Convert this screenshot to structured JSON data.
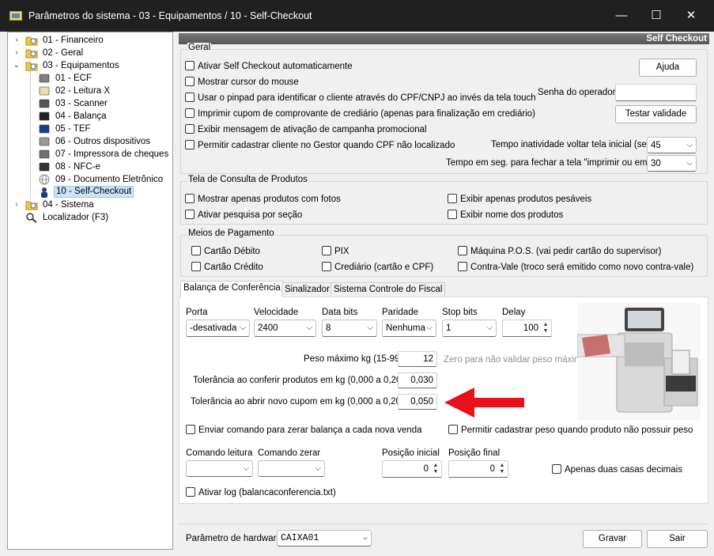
{
  "window": {
    "title": "Parâmetros do sistema - 03 - Equipamentos / 10 - Self-Checkout",
    "minimize": "—",
    "maximize": "☐",
    "close": "✕"
  },
  "tree": [
    {
      "label": "01 - Financeiro",
      "icon": "folder-search-icon",
      "expand": "›"
    },
    {
      "label": "02 - Geral",
      "icon": "folder-search-icon",
      "expand": "›"
    },
    {
      "label": "03 - Equipamentos",
      "icon": "open-folder-icon",
      "expand": "⌄"
    },
    {
      "label": "01 - ECF",
      "icon": "printer-icon"
    },
    {
      "label": "02 - Leitura X",
      "icon": "document-icon"
    },
    {
      "label": "03 - Scanner",
      "icon": "scanner-icon"
    },
    {
      "label": "04 - Balança",
      "icon": "scale-icon"
    },
    {
      "label": "05 - TEF",
      "icon": "card-icon"
    },
    {
      "label": "06 - Outros dispositivos",
      "icon": "devices-icon"
    },
    {
      "label": "07 - Impressora de cheques",
      "icon": "check-printer-icon"
    },
    {
      "label": "08 - NFC-e",
      "icon": "qr-code-icon"
    },
    {
      "label": "09 - Documento Eletrônico",
      "icon": "globe-icon"
    },
    {
      "label": "10 - Self-Checkout",
      "icon": "person-icon"
    },
    {
      "label": "04 - Sistema",
      "icon": "folder-search-icon",
      "expand": "›"
    },
    {
      "label": "Localizador (F3)",
      "icon": "magnifier-icon"
    }
  ],
  "header": "Self Checkout",
  "geral": {
    "legend": "Geral",
    "checks": [
      "Ativar Self Checkout automaticamente",
      "Mostrar cursor do mouse",
      "Usar o pinpad para identificar o cliente através do CPF/CNPJ ao invés da tela touch",
      "Imprimir cupom de comprovante de crediário (apenas para finalização em crediário)",
      "Exibir mensagem de ativação de campanha promocional",
      "Permitir cadastrar cliente no Gestor quando CPF não localizado"
    ],
    "help_button": "Ajuda",
    "operator_password_label": "Senha do operador",
    "test_button": "Testar validade",
    "inactivity_label": "Tempo inatividade voltar tela inicial (seg)",
    "inactivity_value": "45",
    "close_label": "Tempo em seg. para fechar a tela \"imprimir ou email\"",
    "close_value": "30"
  },
  "consulta": {
    "legend": "Tela de Consulta de Produtos",
    "checks": [
      "Mostrar apenas produtos com fotos",
      "Ativar pesquisa por seção",
      "Exibir apenas produtos pesáveis",
      "Exibir nome dos produtos"
    ]
  },
  "pagamento": {
    "legend": "Meios de Pagamento",
    "checks": [
      "Cartão Débito",
      "Cartão Crédito",
      "PIX",
      "Crediário (cartão e CPF)",
      "Máquina P.O.S. (vai pedir cartão do supervisor)",
      "Contra-Vale (troco será emitido como novo contra-vale)"
    ]
  },
  "tabs": [
    "Balança de Conferência",
    "Sinalizador",
    "Sistema Controle do Fiscal"
  ],
  "balanca": {
    "porta_label": "Porta",
    "porta": "-desativada",
    "velocidade_label": "Velocidade",
    "velocidade": "2400",
    "databits_label": "Data bits",
    "databits": "8",
    "paridade_label": "Paridade",
    "paridade": "Nenhuma",
    "stopbits_label": "Stop bits",
    "stopbits": "1",
    "delay_label": "Delay",
    "delay": "100",
    "peso_max_label": "Peso máximo kg (15-99)",
    "peso_max": "12",
    "peso_hint": "Zero para não validar peso máximo",
    "tol_conferir_label": "Tolerância ao conferir produtos em kg (0,000 a 0,200)",
    "tol_conferir": "0,030",
    "tol_abrir_label": "Tolerância ao abrir novo cupom em kg (0,000 a 0,200)",
    "tol_abrir": "0,050",
    "check_zerar": "Enviar comando para zerar balança a cada nova venda",
    "check_peso": "Permitir cadastrar peso quando produto não possuir peso",
    "cmd_leitura_label": "Comando leitura",
    "cmd_zerar_label": "Comando zerar",
    "pos_ini_label": "Posição inicial",
    "pos_ini": "0",
    "pos_fim_label": "Posição final",
    "pos_fim": "0",
    "check_duas": "Apenas duas casas decimais",
    "check_log": "Ativar log (balancaconferencia.txt)"
  },
  "footer": {
    "hardware_label": "Parâmetro de hardware",
    "hardware_value": "CAIXA01",
    "save": "Gravar",
    "exit": "Sair"
  },
  "colors": {
    "arrow": "#e8101a",
    "titlebar": "#202020",
    "header_strip": "#666666"
  }
}
